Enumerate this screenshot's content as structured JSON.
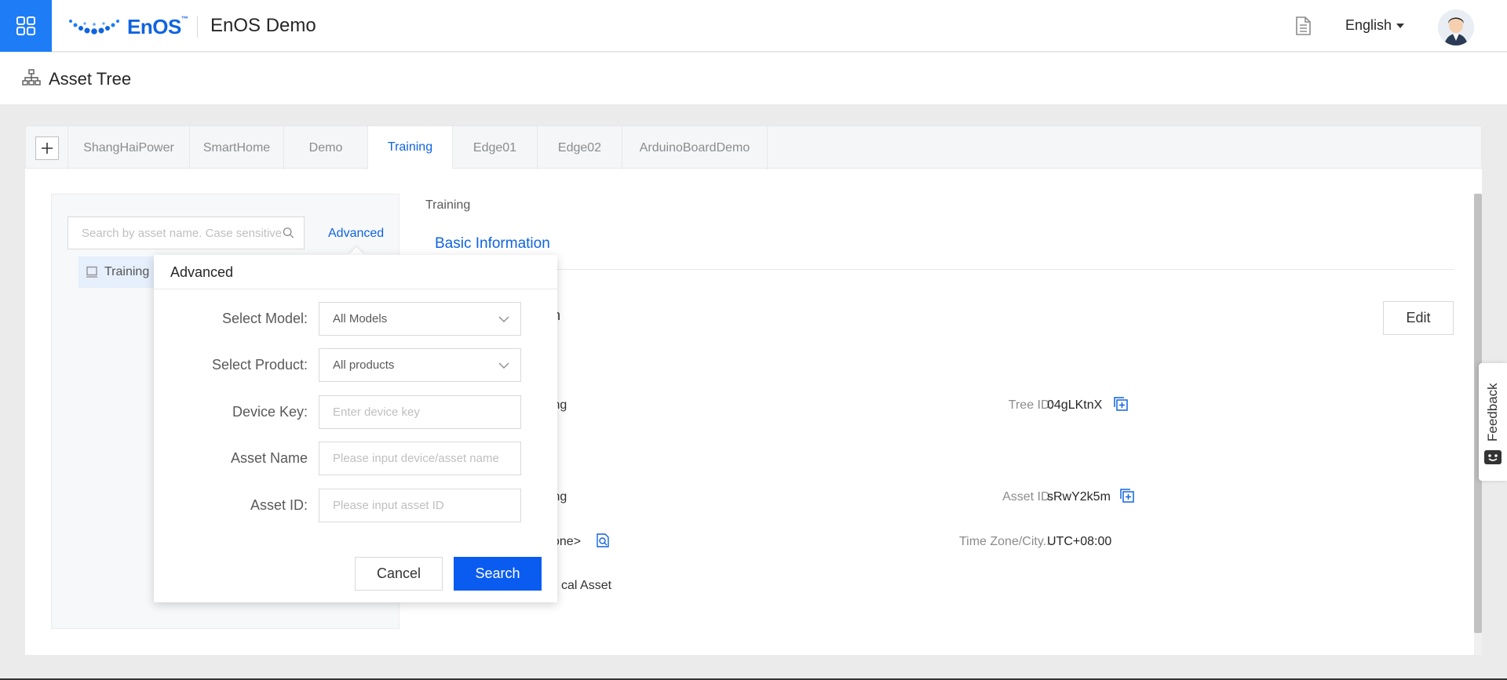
{
  "topbar": {
    "logo_text": "EnOS",
    "logo_tm": "™",
    "app_title": "EnOS Demo",
    "language": "English"
  },
  "page": {
    "title": "Asset Tree"
  },
  "tabs": [
    {
      "label": "ShangHaiPower",
      "active": false
    },
    {
      "label": "SmartHome",
      "active": false
    },
    {
      "label": "Demo",
      "active": false
    },
    {
      "label": "Training",
      "active": true
    },
    {
      "label": "Edge01",
      "active": false
    },
    {
      "label": "Edge02",
      "active": false
    },
    {
      "label": "ArduinoBoardDemo",
      "active": false
    }
  ],
  "tree_panel": {
    "search_placeholder": "Search by asset name. Case sensitive",
    "advanced_label": "Advanced",
    "root_node": "Training"
  },
  "details": {
    "breadcrumb": "Training",
    "section_tab": "Basic Information",
    "edit_label": "Edit",
    "heading_partial": "n",
    "name_partial": "ning",
    "tree_id_label": "Tree ID:",
    "tree_id_value": "04gLKtnX",
    "asset_name_partial": "ning",
    "asset_id_label": "Asset ID:",
    "asset_id_value": "sRwY2k5m",
    "location_partial": "one>",
    "timezone_label": "Time Zone/City...",
    "timezone_value": "UTC+08:00",
    "type_partial": "cal Asset"
  },
  "feedback": {
    "label": "Feedback"
  },
  "advanced_popover": {
    "title": "Advanced",
    "model_label": "Select Model:",
    "model_value": "All Models",
    "product_label": "Select Product:",
    "product_value": "All products",
    "device_key_label": "Device Key:",
    "device_key_placeholder": "Enter device key",
    "asset_name_label": "Asset Name",
    "asset_name_placeholder": "Please input device/asset name",
    "asset_id_label": "Asset ID:",
    "asset_id_placeholder": "Please input asset ID",
    "cancel_label": "Cancel",
    "search_label": "Search"
  },
  "colors": {
    "accent": "#1064e0",
    "primary_button": "#0a5bf0",
    "launcher": "#1e7df6"
  }
}
